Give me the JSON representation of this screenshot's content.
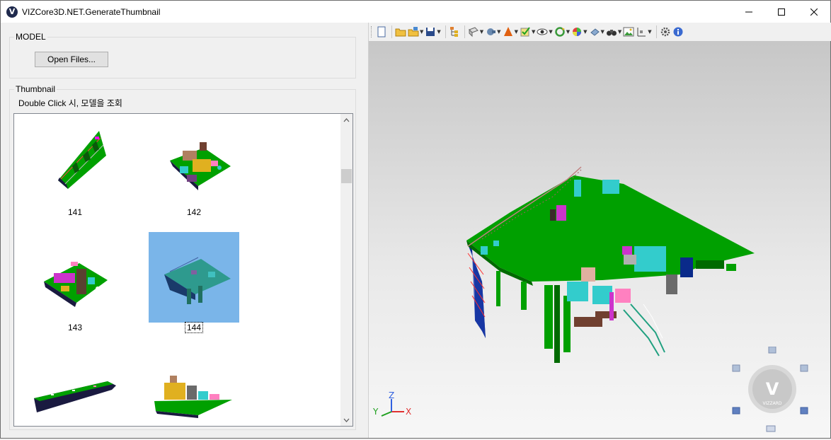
{
  "window": {
    "title": "VIZCore3D.NET.GenerateThumbnail",
    "app_icon_letter": "V",
    "minimize_symbol": "—",
    "maximize_symbol": "☐",
    "close_symbol": "✕"
  },
  "model_group": {
    "label": "MODEL",
    "open_files_label": "Open Files..."
  },
  "thumbnail_group": {
    "label": "Thumbnail",
    "hint": "Double Click 시, 모델을 조회",
    "selected_index": 3,
    "items": [
      {
        "label": "141"
      },
      {
        "label": "142"
      },
      {
        "label": "143"
      },
      {
        "label": "144"
      },
      {
        "label": ""
      },
      {
        "label": ""
      }
    ]
  },
  "toolbar": {
    "icons": [
      "new-file-icon",
      "open-folder-icon",
      "open-multi-icon",
      "save-icon",
      "tree-icon",
      "box-view-icon",
      "camera-icon",
      "cone-icon",
      "checkbox-icon",
      "eye-icon",
      "rotate-icon",
      "color-icon",
      "move-icon",
      "binoculars-icon",
      "image-icon",
      "measure-icon",
      "settings-icon",
      "info-icon"
    ]
  },
  "viewer": {
    "axis_x": "X",
    "axis_y": "Y",
    "axis_z": "Z",
    "logo_text": "VIZZARD",
    "logo_letter": "V"
  },
  "colors": {
    "deck_green": "#00a000",
    "hull_blue": "#2020a0",
    "selection_blue": "#7ab5e9",
    "cyan": "#33cccc"
  }
}
